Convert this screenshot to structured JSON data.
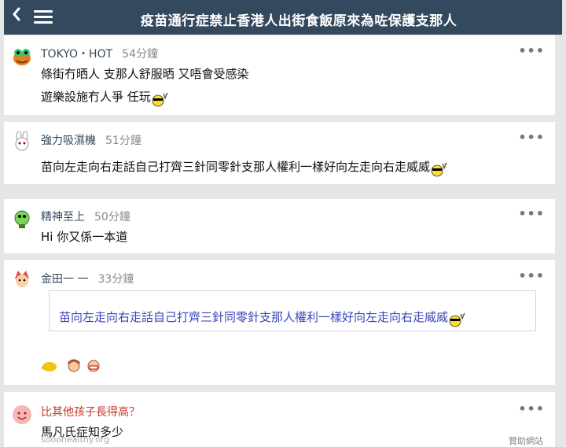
{
  "header": {
    "title": "疫苗通行症禁止香港人出街食飯原來為咗保護支那人",
    "back_icon": "chevron-left-icon",
    "menu_icon": "hamburger-menu-icon",
    "bg_color": "#34495e"
  },
  "posts": [
    {
      "author": "TOKYO・HOT",
      "time": "54分鐘",
      "lines": [
        "條街冇晒人 支那人舒服晒 又唔會受感染",
        "遊樂設施冇人爭 任玩"
      ]
    },
    {
      "author": "強力吸濕機",
      "time": "51分鐘",
      "lines": [
        "苗向左走向右走話自己打齊三針同零針支那人權利一樣好向左走向右走威威"
      ]
    },
    {
      "author": "精神至上",
      "time": "50分鐘",
      "lines": [
        "Hi 你又係一本道"
      ]
    },
    {
      "author": "金田一 一",
      "time": "33分鐘",
      "quote": "苗向左走向右走話自己打齊三針同零針支那人權利一樣好向左走向右走威威"
    }
  ],
  "ad": {
    "title": "比其他孩子長得高？",
    "text": "馬凡氏症知多少",
    "source": "sooohealthy.org",
    "sponsor": "贊助網站"
  },
  "colors": {
    "author": "#34495e",
    "quote_text": "#3948b8",
    "ad_title": "#c0392b"
  }
}
